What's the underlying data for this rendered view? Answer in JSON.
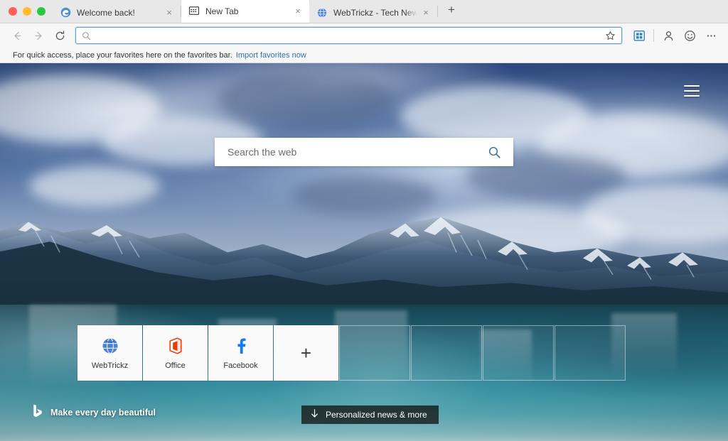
{
  "window": {
    "traffic_lights": [
      {
        "name": "close",
        "color": "#ff5f57"
      },
      {
        "name": "minimize",
        "color": "#febc2e"
      },
      {
        "name": "zoom",
        "color": "#28c840"
      }
    ]
  },
  "tabs": [
    {
      "title": "Welcome back!",
      "icon": "edge-logo-icon",
      "active": false,
      "close_label": "×"
    },
    {
      "title": "New Tab",
      "icon": "new-tab-page-icon",
      "active": true,
      "close_label": "×"
    },
    {
      "title": "WebTrickz - Tech News, Phone",
      "icon": "webtrickz-globe-icon",
      "active": false,
      "close_label": "×"
    }
  ],
  "new_tab_button": {
    "label": "+"
  },
  "toolbar": {
    "back_label": "Back",
    "forward_label": "Forward",
    "refresh_label": "Refresh",
    "address": {
      "value": "",
      "placeholder": ""
    },
    "favorite_label": "Add this page to favorites",
    "collections_label": "Collections",
    "profile_label": "Profile",
    "feedback_label": "Send a smile",
    "settings_label": "Settings and more"
  },
  "favorites_bar": {
    "message": "For quick access, place your favorites here on the favorites bar.",
    "import_link": "Import favorites now"
  },
  "newtab": {
    "menu_label": "Page settings",
    "search": {
      "placeholder": "Search the web",
      "value": "",
      "button_label": "Search"
    },
    "tiles": [
      {
        "label": "WebTrickz",
        "icon": "webtrickz-globe-icon",
        "type": "site"
      },
      {
        "label": "Office",
        "icon": "office-logo-icon",
        "type": "site"
      },
      {
        "label": "Facebook",
        "icon": "facebook-f-icon",
        "type": "site"
      },
      {
        "label": "",
        "icon": "plus-icon",
        "type": "add",
        "plus": "+"
      },
      {
        "label": "",
        "icon": "",
        "type": "empty"
      },
      {
        "label": "",
        "icon": "",
        "type": "empty"
      },
      {
        "label": "",
        "icon": "",
        "type": "empty"
      },
      {
        "label": "",
        "icon": "",
        "type": "empty"
      }
    ],
    "bing": {
      "logo": "bing-logo-icon",
      "tagline": "Make every day beautiful"
    },
    "news_button": {
      "icon": "arrow-down-icon",
      "label": "Personalized news & more"
    }
  },
  "colors": {
    "accent_blue": "#2b6fb5",
    "address_focus_border": "#5aa0d8",
    "tabstrip_bg": "#e8e8e8",
    "toolbar_bg": "#f7f7f7",
    "office_orange": "#eb3c00",
    "facebook_blue": "#1877f2",
    "pill_bg": "rgba(20,20,20,0.78)"
  }
}
